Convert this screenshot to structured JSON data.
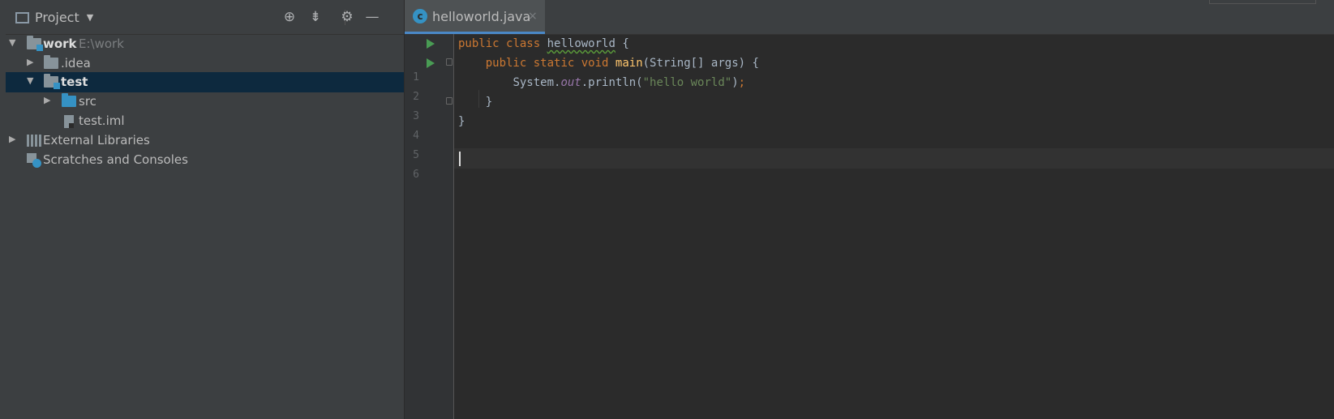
{
  "project_panel": {
    "title": "Project",
    "dropdown_caret": "▼",
    "tree": [
      {
        "label": "work",
        "hint": "E:\\work",
        "arrow": "▼",
        "icon": "module-folder-icon"
      },
      {
        "label": ".idea",
        "arrow": "▶",
        "icon": "folder-icon"
      },
      {
        "label": "test",
        "arrow": "▼",
        "icon": "module-folder-icon",
        "selected": true
      },
      {
        "label": "src",
        "arrow": "▶",
        "icon": "source-folder-icon"
      },
      {
        "label": "test.iml",
        "icon": "iml-file-icon"
      },
      {
        "label": "External Libraries",
        "arrow": "▶",
        "icon": "libraries-icon"
      },
      {
        "label": "Scratches and Consoles",
        "icon": "scratches-icon"
      }
    ],
    "header_buttons": [
      "locate-icon",
      "collapse-all-icon",
      "gear-icon",
      "hide-icon"
    ]
  },
  "editor": {
    "tab": {
      "label": "helloworld.java",
      "close": "×",
      "icon_letter": "c"
    },
    "line_numbers": [
      "1",
      "2",
      "3",
      "4",
      "5",
      "6"
    ],
    "code": {
      "l1": {
        "kw1": "public",
        "kw2": "class",
        "name": "helloworld",
        "rest": " {"
      },
      "l2": {
        "kw1": "public",
        "kw2": "static",
        "kw3": "void",
        "fn": "main",
        "rest": "(String[] args) {"
      },
      "l3": {
        "pre": "System.",
        "field": "out",
        "mid": ".println(",
        "str": "\"hello world\"",
        "end": ")",
        "semi": ";"
      },
      "l4": {
        "text": "}"
      },
      "l5": {
        "text": "}"
      }
    }
  },
  "colors": {
    "keyword": "#cc7832",
    "function": "#ffc66d",
    "string": "#6a8759",
    "field": "#9876aa",
    "text": "#a9b7c6",
    "selection": "#0d293e",
    "run": "#499c54"
  }
}
